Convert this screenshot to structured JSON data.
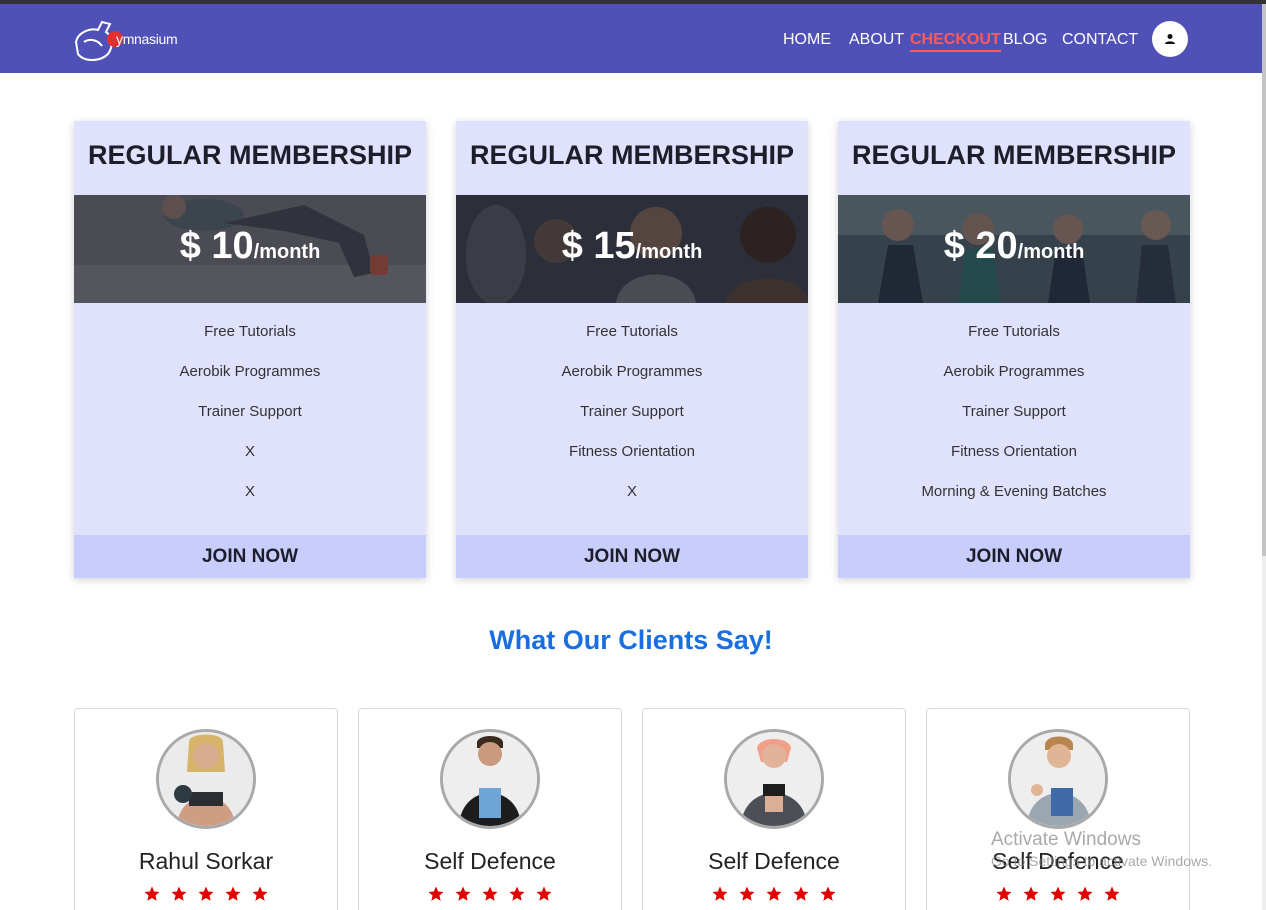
{
  "header": {
    "logo_text": "ymnasium",
    "nav": [
      {
        "label": "HOME",
        "active": false
      },
      {
        "label": "ABOUT",
        "active": false
      },
      {
        "label": "CHECKOUT",
        "active": true
      },
      {
        "label": "BLOG",
        "active": false
      },
      {
        "label": "CONTACT",
        "active": false
      }
    ],
    "user_icon": "user-icon",
    "colors": {
      "navbar": "#4f51b7",
      "active": "#ff5b5b"
    }
  },
  "plans": [
    {
      "title": "REGULAR MEMBERSHIP",
      "price": "$ 10",
      "unit": "/month",
      "features": [
        "Free Tutorials",
        "Aerobik Programmes",
        "Trainer Support",
        "X",
        "X"
      ],
      "cta": "JOIN NOW"
    },
    {
      "title": "REGULAR MEMBERSHIP",
      "price": "$ 15",
      "unit": "/month",
      "features": [
        "Free Tutorials",
        "Aerobik Programmes",
        "Trainer Support",
        "Fitness Orientation",
        "X"
      ],
      "cta": "JOIN NOW"
    },
    {
      "title": "REGULAR MEMBERSHIP",
      "price": "$ 20",
      "unit": "/month",
      "features": [
        "Free Tutorials",
        "Aerobik Programmes",
        "Trainer Support",
        "Fitness Orientation",
        "Morning & Evening Batches"
      ],
      "cta": "JOIN NOW"
    }
  ],
  "testimonials": {
    "title": "What Our Clients Say!",
    "items": [
      {
        "name": "Rahul Sorkar",
        "rating": 5
      },
      {
        "name": "Self Defence",
        "rating": 5
      },
      {
        "name": "Self Defence",
        "rating": 5
      },
      {
        "name": "Self Defence",
        "rating": 5
      }
    ],
    "colors": {
      "title": "#1a6fe0",
      "star": "#e00000"
    }
  },
  "watermark": {
    "title": "Activate Windows",
    "subtitle": "Go to Settings to activate Windows."
  }
}
